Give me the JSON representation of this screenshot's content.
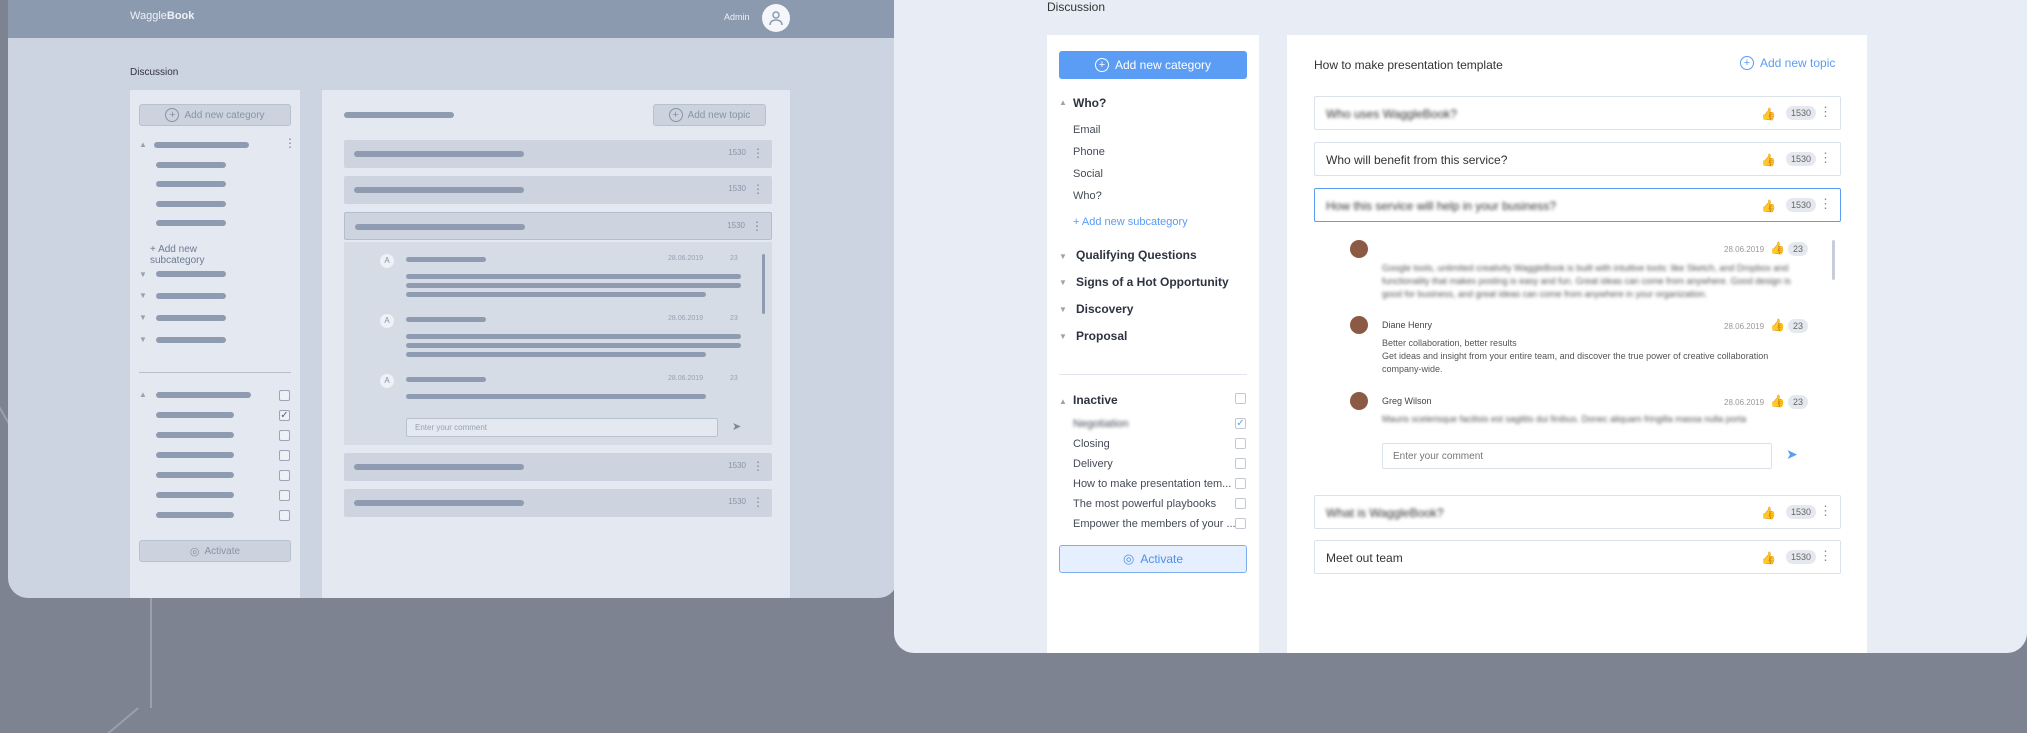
{
  "wireframe": {
    "brand_prefix": "Waggle",
    "brand_bold": "Book",
    "admin_label": "Admin",
    "section_title": "Discussion",
    "add_category": "Add new category",
    "add_subcategory": "+ Add new subcategory",
    "activate": "Activate",
    "add_topic": "Add new topic",
    "comment_placeholder": "Enter your comment",
    "like_counts": [
      "1530",
      "1530",
      "1530",
      "1530",
      "1530"
    ],
    "comment_dates": [
      "28.06.2019",
      "28.06.2019",
      "28.06.2019"
    ],
    "comment_counts": [
      "23",
      "23",
      "23"
    ]
  },
  "ui": {
    "section_title": "Discussion",
    "add_category": "Add new category",
    "add_topic": "Add new topic",
    "main_title": "How to make presentation template",
    "categories": [
      {
        "label": "Who?",
        "expanded": true,
        "subs": [
          "Email",
          "Phone",
          "Social",
          "Who?"
        ],
        "add_sub": "+ Add new subcategory"
      },
      {
        "label": "Qualifying Questions"
      },
      {
        "label": "Signs of a Hot Opportunity"
      },
      {
        "label": "Discovery"
      },
      {
        "label": "Proposal"
      }
    ],
    "inactive": {
      "label": "Inactive",
      "items": [
        {
          "label": "Negotiation",
          "checked": true
        },
        {
          "label": "Closing",
          "checked": false
        },
        {
          "label": "Delivery",
          "checked": false
        },
        {
          "label": "How to make presentation tem...",
          "checked": false
        },
        {
          "label": "The most powerful playbooks",
          "checked": false
        },
        {
          "label": "Empower the members of your ...",
          "checked": false
        }
      ]
    },
    "activate": "Activate",
    "topics": [
      {
        "title": "Who uses WaggleBook?",
        "count": "1530"
      },
      {
        "title": "Who will benefit from this service?",
        "count": "1530"
      },
      {
        "title": "How this service will help in your business?",
        "count": "1530"
      },
      {
        "title": "What is WaggleBook?",
        "count": "1530"
      },
      {
        "title": "Meet out team",
        "count": "1530"
      }
    ],
    "comments": [
      {
        "name": "",
        "date": "28.06.2019",
        "count": "23",
        "text": "Google tools, unlimited creativity WaggleBook is built with intuitive tools: like Sketch, and Dropbox and functionality that makes posting is easy and fun. Great ideas can come from anywhere. Good design is good for business, and great ideas can come from anywhere in your organization."
      },
      {
        "name": "Diane Henry",
        "date": "28.06.2019",
        "count": "23",
        "text": "Better collaboration, better results\nGet ideas and insight from your entire team, and discover the true power of creative collaboration company-wide."
      },
      {
        "name": "Greg Wilson",
        "date": "28.06.2019",
        "count": "23",
        "text": "Mauris scelerisque facilisis est sagittis dui finibus. Donec aliquam fringilla massa nulla porta"
      }
    ],
    "comment_placeholder": "Enter your comment"
  }
}
